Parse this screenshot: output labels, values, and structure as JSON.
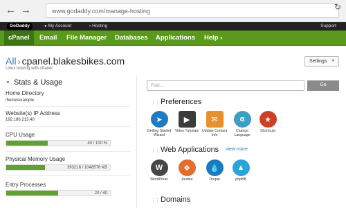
{
  "browser": {
    "url": "www.godaddy.com/manage-hosting",
    "back_icon": "back-arrow-icon",
    "forward_icon": "forward-arrow-icon",
    "reload_icon": "reload-icon"
  },
  "topbar": {
    "logo": "GoDaddy",
    "account": "My Account",
    "hosting": "Hosting",
    "support": "Support"
  },
  "menu": [
    "cPanel",
    "Email",
    "File Manager",
    "Databases",
    "Applications",
    "Help"
  ],
  "page": {
    "breadcrumb_all": "All",
    "host": "cpanel.blakesbikes.com",
    "subtitle": "Linux hosting with cPanel",
    "settings": "Settings"
  },
  "stats": {
    "title": "Stats & Usage",
    "home_label": "Home Directory",
    "home_value": "/home/example",
    "ip_label": "Website(s) IP Address",
    "ip_value": "192.186.213.40",
    "cpu_label": "CPU Usage",
    "cpu_text": "40 / 100 %",
    "cpu_fraction": 0.4,
    "mem_label": "Physical Memory Usage",
    "mem_text": "393216 / 1048576 KB",
    "mem_fraction": 0.375,
    "entry_label": "Entry Processes",
    "entry_text": "20 / 40",
    "entry_fraction": 0.5
  },
  "search": {
    "placeholder": "Find...",
    "go": "Go"
  },
  "preferences": {
    "title": "Preferences",
    "items": [
      {
        "label": "Getting Started Wizard",
        "icon": "wizard-icon",
        "color": "#1d7cc4"
      },
      {
        "label": "Video Tutorials",
        "icon": "video-icon",
        "color": "#3b3b3b"
      },
      {
        "label": "Update Contact Info",
        "icon": "contact-info-icon",
        "color": "#e8902b"
      },
      {
        "label": "Change Language",
        "icon": "language-icon",
        "color": "#3c9fc8"
      },
      {
        "label": "Shortcuts",
        "icon": "star-icon",
        "color": "#cf3f25"
      }
    ]
  },
  "apps": {
    "title": "Web Applications",
    "view_more": "view more",
    "items": [
      {
        "label": "WordPress",
        "icon": "wordpress-icon",
        "color": "#464646"
      },
      {
        "label": "Joomla",
        "icon": "joomla-icon",
        "color": "#e46d2b"
      },
      {
        "label": "Drupal",
        "icon": "drupal-icon",
        "color": "#1a7bbf"
      },
      {
        "label": "phpBB",
        "icon": "phpbb-icon",
        "color": "#29a4dc"
      }
    ]
  },
  "domains": {
    "title": "Domains"
  }
}
